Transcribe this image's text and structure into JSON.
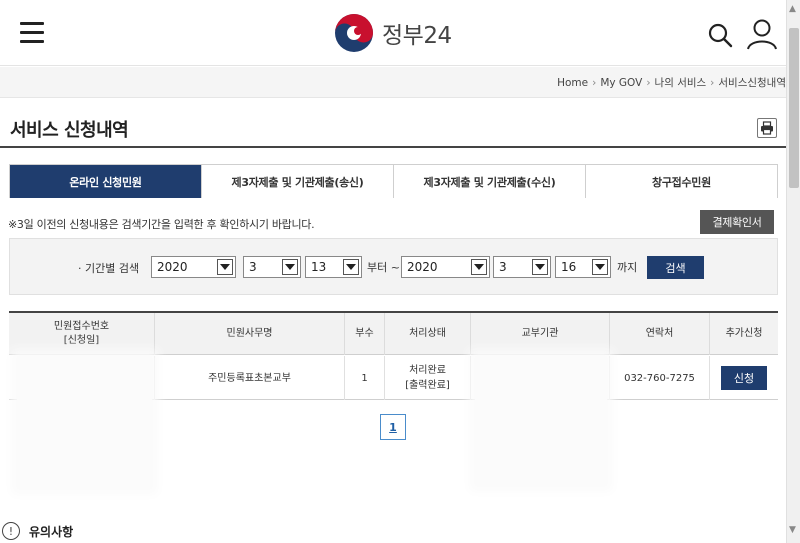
{
  "header": {
    "logo_text": "정부24"
  },
  "breadcrumb": [
    "Home",
    "My GOV",
    "나의 서비스",
    "서비스신청내역"
  ],
  "page": {
    "title": "서비스 신청내역"
  },
  "tabs": [
    {
      "label": "온라인 신청민원",
      "active": true
    },
    {
      "label": "제3자제출 및 기관제출(송신)",
      "active": false
    },
    {
      "label": "제3자제출 및 기관제출(수신)",
      "active": false
    },
    {
      "label": "창구접수민원",
      "active": false
    }
  ],
  "notice": "※3일 이전의 신청내용은 검색기간을 입력한 후 확인하시기 바랍니다.",
  "confirm_button": "결제확인서",
  "search": {
    "label": "· 기간별 검색",
    "from": {
      "year": "2020",
      "month": "3",
      "day": "13"
    },
    "from_suffix": "부터 ~",
    "to": {
      "year": "2020",
      "month": "3",
      "day": "16"
    },
    "to_suffix": "까지",
    "button": "검색"
  },
  "table": {
    "headers": {
      "receipt_line1": "민원접수번호",
      "receipt_line2": "[신청일]",
      "name": "민원사무명",
      "count": "부수",
      "status": "처리상태",
      "agency": "교부기관",
      "contact": "연락처",
      "extra": "추가신청"
    },
    "rows": [
      {
        "name": "주민등록표초본교부",
        "count": "1",
        "status_line1": "처리완료",
        "status_line2": "[출력완료]",
        "contact": "032-760-7275",
        "extra_button": "신청"
      }
    ]
  },
  "pagination": {
    "current": "1"
  },
  "caution": {
    "icon": "!",
    "title": "유의사항"
  },
  "colors": {
    "navy": "#1f3d6e",
    "confirm_gray": "#555555"
  }
}
